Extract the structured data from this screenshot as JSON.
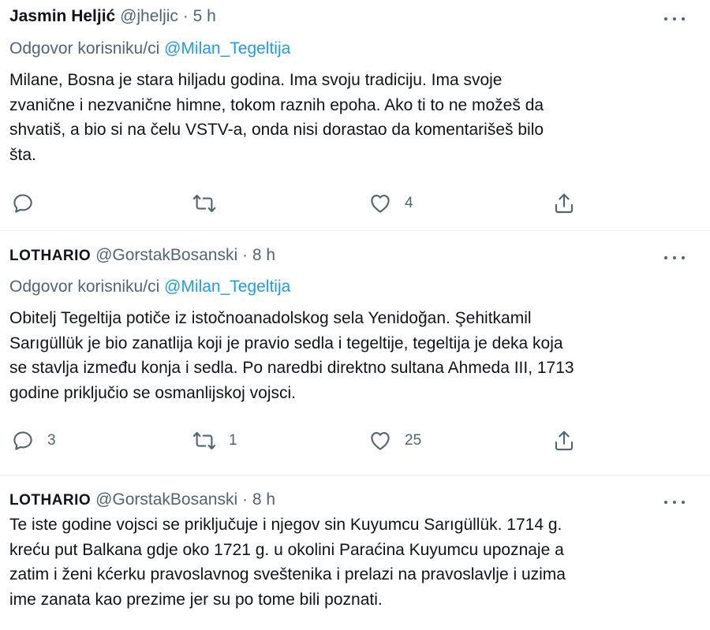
{
  "tweets": [
    {
      "author": "Jasmin Heljić",
      "handle": "@jheljic",
      "separator": "·",
      "time": "5 h",
      "reply_prefix": "Odgovor korisniku/ci",
      "reply_mention": "@Milan_Tegeltija",
      "text_lines": [
        "Milane, Bosna je stara hiljadu godina. Ima svoju tradiciju. Ima svoje",
        "zvanične i nezvanične himne, tokom raznih epoha. Ako ti to ne možeš da",
        "shvatiš, a bio si na čelu VSTV-a, onda nisi dorastao da komentarišeš bilo",
        "šta."
      ],
      "reply_count": "",
      "retweet_count": "",
      "like_count": "4"
    },
    {
      "author": "LOTHARIO",
      "handle": "@GorstakBosanski",
      "separator": "·",
      "time": "8 h",
      "reply_prefix": "Odgovor korisniku/ci",
      "reply_mention": "@Milan_Tegeltija",
      "text_lines": [
        "Obitelj Tegeltija potiče iz istočnoanadolskog sela Yenidoğan. Şehitkamil",
        "Sarıgüllük je bio zanatlija koji je pravio sedla i tegeltije, tegeltija je deka koja",
        "se stavlja između konja i sedla. Po naredbi direktno sultana Ahmeda III, 1713",
        "godine priključio se osmanlijskoj vojsci."
      ],
      "reply_count": "3",
      "retweet_count": "1",
      "like_count": "25"
    },
    {
      "author": "LOTHARIO",
      "handle": "@GorstakBosanski",
      "separator": "·",
      "time": "8 h",
      "text_lines": [
        "Te iste godine vojsci se priključuje i njegov sin Kuyumcu Sarıgüllük. 1714 g.",
        "kreću put Balkana gdje oko 1721 g. u okolini Paraćina Kuyumcu upoznaje a",
        "zatim i ženi kćerku pravoslavnog sveštenika i prelazi na pravoslavlje i uzima",
        "ime zanata kao prezime jer su po tome bili poznati."
      ]
    }
  ],
  "colors": {
    "text": "#0f1419",
    "secondary": "#536471",
    "mention": "#1d9bf0",
    "divider": "#eff3f4"
  },
  "icons": [
    "more-icon",
    "reply-icon",
    "retweet-icon",
    "like-icon",
    "share-icon"
  ]
}
